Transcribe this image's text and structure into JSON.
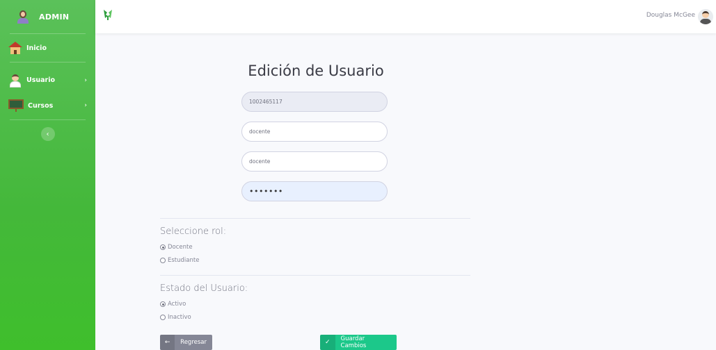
{
  "sidebar": {
    "brand": "ADMIN",
    "items": [
      {
        "label": "Inicio"
      },
      {
        "label": "Usuario"
      },
      {
        "label": "Cursos"
      }
    ],
    "chevron": "›",
    "toggle": "‹"
  },
  "topbar": {
    "user_name": "Douglas McGee"
  },
  "form": {
    "title": "Edición de Usuario",
    "id_value": "1002465117",
    "field2_value": "docente",
    "field3_value": "docente",
    "password_value": "•••••••",
    "role_label": "Seleccione rol:",
    "roles": [
      {
        "label": "Docente",
        "checked": true
      },
      {
        "label": "Estudiante",
        "checked": false
      }
    ],
    "status_label": "Estado del Usuario:",
    "statuses": [
      {
        "label": "Activo",
        "checked": true
      },
      {
        "label": "Inactivo",
        "checked": false
      }
    ],
    "back_button": "Regresar",
    "save_button": "Guardar Cambios",
    "back_icon": "←",
    "save_icon": "✓"
  },
  "colors": {
    "sidebar": "#44b83a",
    "save": "#1cc88a",
    "back": "#858796"
  }
}
